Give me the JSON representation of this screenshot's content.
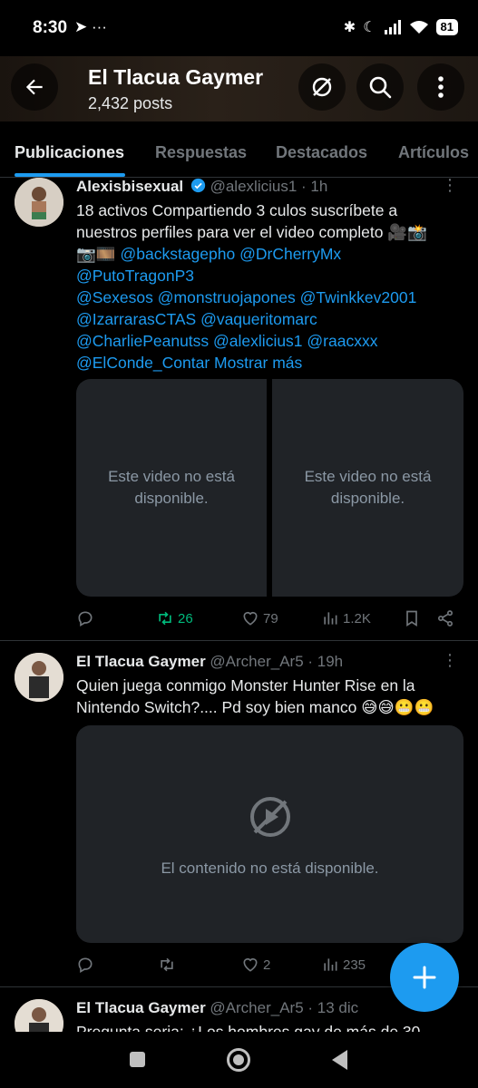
{
  "status_bar": {
    "time": "8:30",
    "left_icons": "➤ ···",
    "battery": "81"
  },
  "header": {
    "title": "El Tlacua Gaymer",
    "posts_count": "2,432 posts"
  },
  "tabs": [
    {
      "label": "Publicaciones",
      "active": true
    },
    {
      "label": "Respuestas"
    },
    {
      "label": "Destacados"
    },
    {
      "label": "Artículos"
    }
  ],
  "tweets": [
    {
      "name": "Alexisbisexual",
      "handle": "@alexlicius1 · 1h",
      "text_line1": "18  activos Compartiendo 3 culos  suscríbete a",
      "text_line2": "nuestros perfiles para ver el video completo 🎥📸",
      "text_line3_prefix": "📷🎞️",
      "mentions": [
        "@backstagepho",
        "@DrCherryMx",
        "@PutoTragonP3",
        "@Sexesos",
        "@monstruojapones",
        "@Twinkkev2001",
        "@IzarrarasCTAS",
        "@vaqueritomarc",
        "@CharliePeanutss",
        "@alexlicius1",
        "@raacxxx",
        "@ElConde_Contar"
      ],
      "show_more": "Mostrar más",
      "media_left": "Este video no está disponible.",
      "media_right": "Este video no está disponible.",
      "retweets": "26",
      "likes": "79",
      "views": "1.2K"
    },
    {
      "name": "El Tlacua Gaymer",
      "handle": "@Archer_Ar5 · 19h",
      "text_line1": "Quien juega conmigo Monster Hunter Rise en la",
      "text_line2": "Nintendo Switch?.... Pd soy bien manco 😅😅😬😬",
      "media_text": "El contenido no está disponible.",
      "replies": "",
      "likes": "2",
      "views": "235"
    },
    {
      "name": "El Tlacua Gaymer",
      "handle": "@Archer_Ar5 · 13 dic",
      "text_line1": "Pregunta seria: ¿Los hombres gay de más de 30"
    }
  ],
  "colors": {
    "accent": "#1d9bf0",
    "retweet_active": "#00ba7c",
    "muted": "#71767b"
  }
}
